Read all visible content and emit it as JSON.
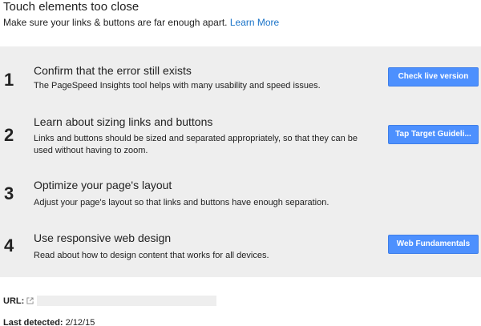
{
  "header": {
    "title": "Touch elements too close",
    "description": "Make sure your links & buttons are far enough apart.",
    "learn_more": "Learn More"
  },
  "steps": [
    {
      "number": "1",
      "title": "Confirm that the error still exists",
      "description": "The PageSpeed Insights tool helps with many usability and speed issues.",
      "button": "Check live version"
    },
    {
      "number": "2",
      "title": "Learn about sizing links and buttons",
      "description": "Links and buttons should be sized and separated appropriately, so that they can be used without having to zoom.",
      "button": "Tap Target Guideli..."
    },
    {
      "number": "3",
      "title": "Optimize your page's layout",
      "description": "Adjust your page's layout so that links and buttons have enough separation."
    },
    {
      "number": "4",
      "title": "Use responsive web design",
      "description": "Read about how to design content that works for all devices.",
      "button": "Web Fundamentals"
    }
  ],
  "footer": {
    "url_label": "URL:",
    "detected_label": "Last detected:",
    "detected_value": "2/12/15"
  },
  "colors": {
    "accent": "#4d90fe",
    "link": "#1a73c8",
    "panel": "#eeeeee"
  }
}
